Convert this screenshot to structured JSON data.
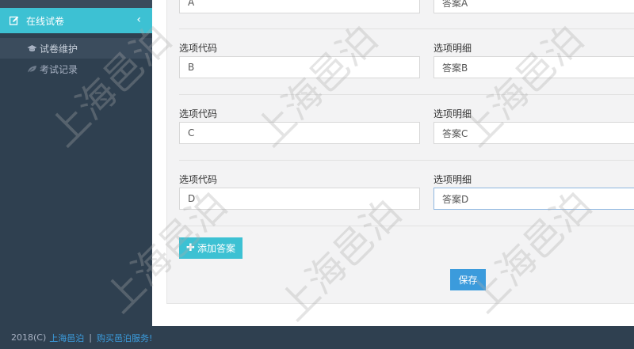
{
  "sidebar": {
    "active_menu": "在线试卷",
    "collapse_symbol": "‹",
    "items": [
      {
        "label": "试卷维护"
      },
      {
        "label": "考试记录"
      }
    ]
  },
  "form": {
    "partial_row": {
      "code_value": "A",
      "detail_value": "答案A"
    },
    "rows": [
      {
        "code_label": "选项代码",
        "code_value": "B",
        "detail_label": "选项明细",
        "detail_value": "答案B"
      },
      {
        "code_label": "选项代码",
        "code_value": "C",
        "detail_label": "选项明细",
        "detail_value": "答案C"
      },
      {
        "code_label": "选项代码",
        "code_value": "D",
        "detail_label": "选项明细",
        "detail_value": "答案D"
      }
    ],
    "add_button": "添加答案",
    "save_button": "保存"
  },
  "footer": {
    "copyright": "2018(C)",
    "company": "上海邑泊",
    "separator": "|",
    "service_link": "购买邑泊服务!"
  },
  "watermark": {
    "text": "上海邑泊"
  },
  "colors": {
    "sidebar_bg": "#2f4050",
    "accent_cyan": "#3dc1d3",
    "save_blue": "#3b9bdc",
    "panel_bg": "#f3f3f4"
  }
}
